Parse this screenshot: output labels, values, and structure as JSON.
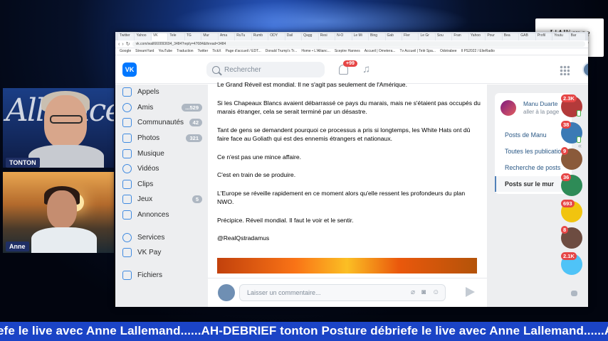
{
  "stream": {
    "logo_text": "L'Alliance Humaine",
    "cameras": [
      {
        "name": "TONTON"
      },
      {
        "name": "Anne"
      }
    ],
    "ticker": "efe le live avec Anne Lallemand......AH-DEBRIEF tonton Posture débriefe le live avec Anne Lallemand......AH"
  },
  "browser": {
    "tabs": [
      "Twitter",
      "Yahoo",
      "VK",
      "Tele",
      "TG",
      "Mur",
      "Ama",
      "RuTu",
      "Rumb",
      "ODY",
      "Dail",
      "Qagg",
      "Resi",
      "N-O",
      "Le Mi",
      "Bing",
      "Gab",
      "FIer",
      "Le Gr",
      "Sou",
      "Fran",
      "Yahoo",
      "Pour",
      "Bea",
      "GAB",
      "Profil",
      "Youtu",
      "Bar"
    ],
    "url": "vk.com/wall660093694_3484?reply=47684&thread=3484",
    "bookmarks": [
      "Google",
      "StreamYard",
      "YouTube",
      "Traduction",
      "Twitter",
      "TickX",
      "Page d'accueil / EDT...",
      "Donald Trump's Tr...",
      "Home • L'Allianc...",
      "Sceptre Hannes",
      "Accueil | Ometera...",
      "Tv Accueil | Telé Spa...",
      "Odotrabee",
      "Il PS2022 / ElieRadio"
    ]
  },
  "vk": {
    "logo": "VK",
    "search_placeholder": "Rechercher",
    "notifications_badge": "+99",
    "sidebar": [
      {
        "label": "Appels",
        "badge": "",
        "icon": "phone-icon"
      },
      {
        "label": "Amis",
        "badge": "...529",
        "icon": "friends-icon"
      },
      {
        "label": "Communautés",
        "badge": "42",
        "icon": "communities-icon"
      },
      {
        "label": "Photos",
        "badge": "321",
        "icon": "photos-icon"
      },
      {
        "label": "Musique",
        "badge": "",
        "icon": "music-icon"
      },
      {
        "label": "Vidéos",
        "badge": "",
        "icon": "video-icon"
      },
      {
        "label": "Clips",
        "badge": "",
        "icon": "clips-icon"
      },
      {
        "label": "Jeux",
        "badge": "5",
        "icon": "games-icon"
      },
      {
        "label": "Annonces",
        "badge": "",
        "icon": "ads-icon"
      },
      {
        "label": "Services",
        "badge": "",
        "icon": "services-icon"
      },
      {
        "label": "VK Pay",
        "badge": "",
        "icon": "vkpay-icon"
      },
      {
        "label": "Fichiers",
        "badge": "",
        "icon": "files-icon"
      }
    ],
    "post": {
      "paragraphs": [
        "Le Grand Réveil est mondial. Il ne s'agit pas seulement de l'Amérique.",
        "Si les Chapeaux Blancs avaient débarrassé ce pays du marais, mais ne s'étaient pas occupés du marais étranger, cela se serait terminé par un désastre.",
        "Tant de gens se demandent pourquoi ce processus a pris si longtemps, les White Hats ont dû faire face au Goliath qui est des ennemis étrangers et nationaux.",
        "Ce n'est pas une mince affaire.",
        "C'est en train de se produire.",
        "L'Europe se réveille rapidement en ce moment alors qu'elle ressent les profondeurs du plan NWO.",
        "Précipice. Réveil mondial. Il faut le voir et le sentir.",
        "@RealQstradamus"
      ],
      "comment_placeholder": "Laisser un commentaire..."
    },
    "right_panel": {
      "name": "Manu Duarte",
      "subtitle": "aller à la page",
      "links": [
        {
          "label": "Posts de Manu",
          "active": false
        },
        {
          "label": "Toutes les publications",
          "active": false
        },
        {
          "label": "Recherche de posts",
          "active": false
        },
        {
          "label": "Posts sur le mur",
          "active": true
        }
      ]
    },
    "chats": [
      {
        "badge": "2.3K",
        "color": "#b33a3a"
      },
      {
        "badge": "38",
        "color": "#3b7ab5"
      },
      {
        "badge": "9",
        "color": "#8a5a3a"
      },
      {
        "badge": "36",
        "color": "#2e8b57"
      },
      {
        "badge": "693",
        "color": "#f1c40f"
      },
      {
        "badge": "8",
        "color": "#6d4c41"
      },
      {
        "badge": "2.1K",
        "color": "#4fc3f7"
      }
    ]
  }
}
